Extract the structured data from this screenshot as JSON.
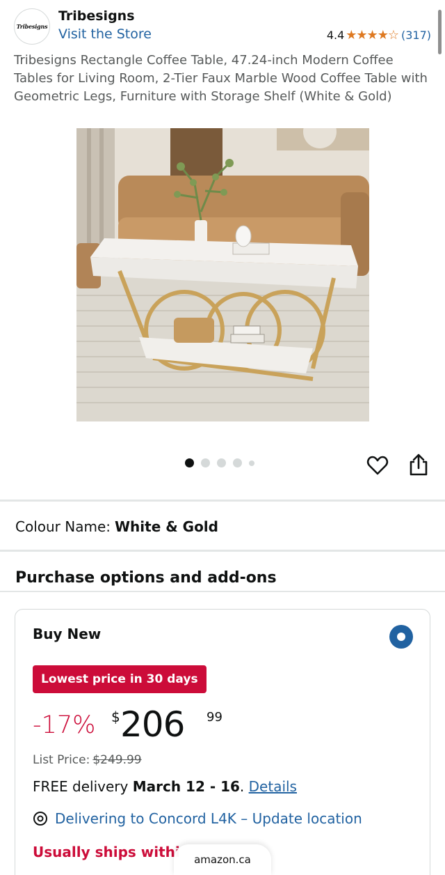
{
  "brand": {
    "logo_text": "Tribesigns",
    "name": "Tribesigns",
    "store_link": "Visit the Store",
    "rating": "4.4",
    "stars": "★★★★☆",
    "rating_count": "(317)"
  },
  "product": {
    "title": "Tribesigns Rectangle Coffee Table, 47.24-inch Modern Coffee Tables for Living Room, 2-Tier Faux Marble Wood Coffee Table with Geometric Legs, Furniture with Storage Shelf (White & Gold)",
    "image_count": 5,
    "active_image": 1
  },
  "colour": {
    "label": "Colour Name:",
    "value": "White & Gold"
  },
  "purchase": {
    "section_title": "Purchase options and add-ons",
    "option_title": "Buy New",
    "badge": "Lowest price in 30 days",
    "discount": "-17%",
    "currency": "$",
    "price_whole": "206",
    "price_fraction": "99",
    "list_price_label": "List Price:",
    "list_price_value": "$249.99",
    "delivery_prefix": "FREE delivery",
    "delivery_dates": "March 12 - 16",
    "delivery_suffix": ".",
    "details_link": "Details",
    "location": "Delivering to Concord L4K – Update location",
    "ships": "Usually ships withi"
  },
  "browser": {
    "domain": "amazon.ca"
  },
  "colors": {
    "link": "#2162a1",
    "deal_red": "#cc0c39",
    "star_orange": "#de7921"
  }
}
